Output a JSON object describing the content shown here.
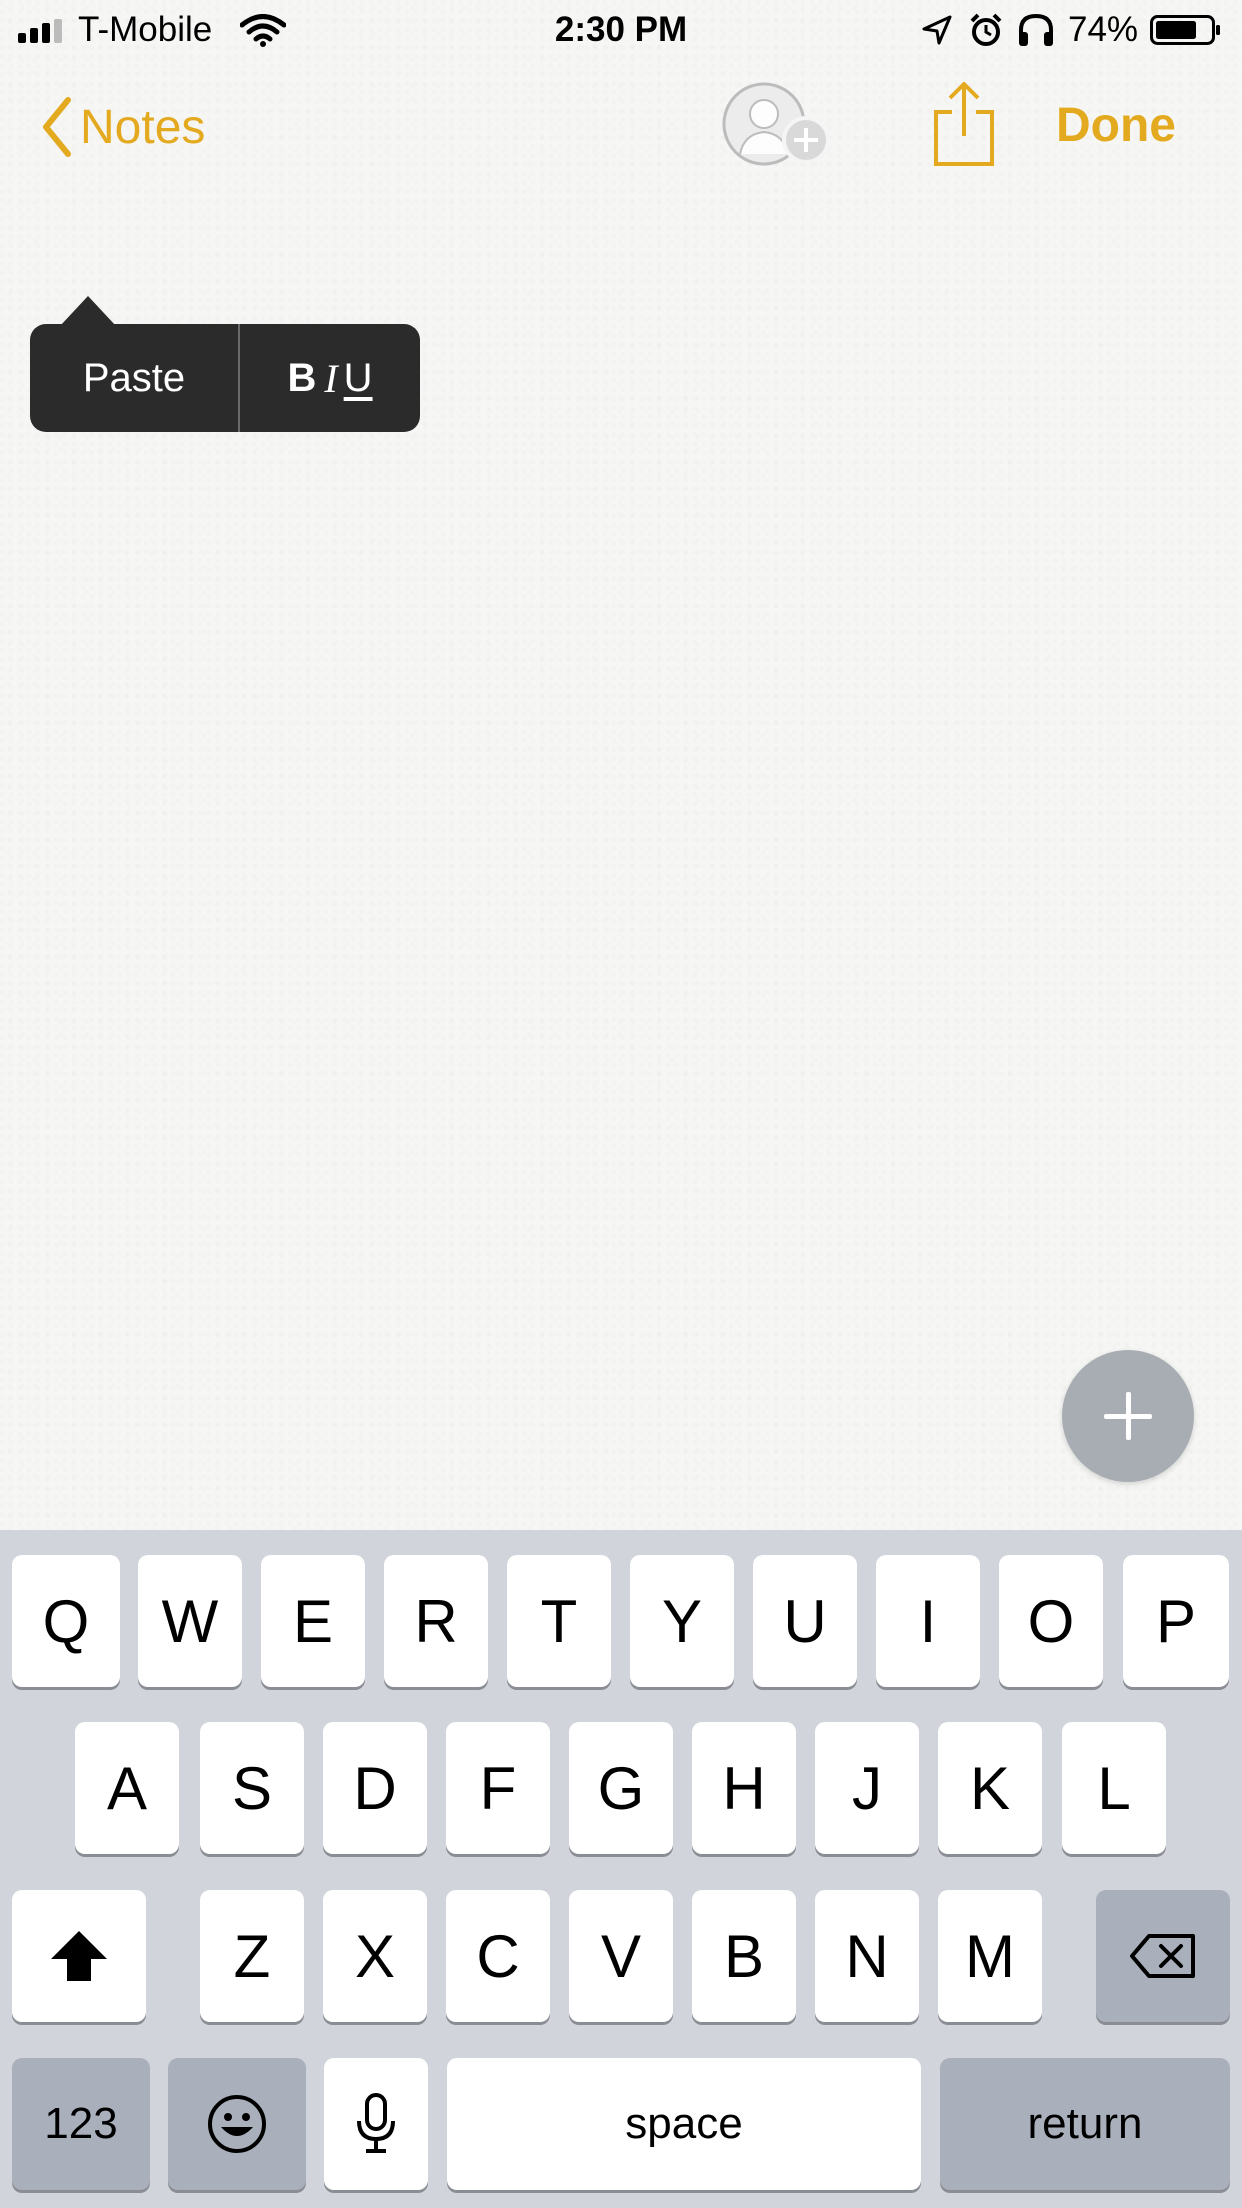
{
  "status_bar": {
    "carrier": "T-Mobile",
    "time": "2:30 PM",
    "battery_percent": "74%",
    "battery_level": 0.74,
    "icons": [
      "signal-icon",
      "wifi-icon",
      "location-icon",
      "alarm-icon",
      "headphones-icon",
      "battery-icon"
    ]
  },
  "nav": {
    "back_label": "Notes",
    "done_label": "Done",
    "accent_color": "#e4aa1f",
    "icons": [
      "chevron-left-icon",
      "add-person-icon",
      "share-icon"
    ]
  },
  "edit_menu": {
    "paste_label": "Paste",
    "bold": "B",
    "italic": "I",
    "underline": "U"
  },
  "keyboard": {
    "row1": [
      "Q",
      "W",
      "E",
      "R",
      "T",
      "Y",
      "U",
      "I",
      "O",
      "P"
    ],
    "row2": [
      "A",
      "S",
      "D",
      "F",
      "G",
      "H",
      "J",
      "K",
      "L"
    ],
    "row3": [
      "Z",
      "X",
      "C",
      "V",
      "B",
      "N",
      "M"
    ],
    "numbers_label": "123",
    "space_label": "space",
    "return_label": "return",
    "icons": [
      "shift-icon",
      "delete-icon",
      "emoji-icon",
      "microphone-icon"
    ]
  }
}
